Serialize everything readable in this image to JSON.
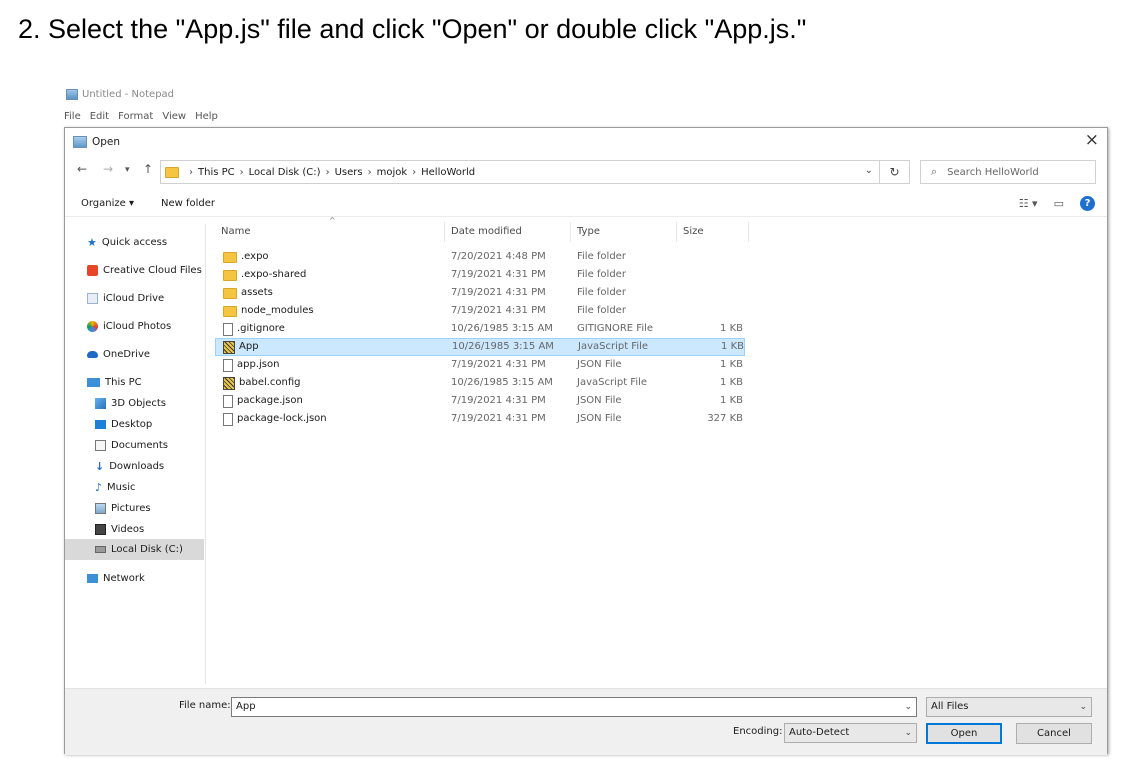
{
  "instruction": "2.  Select the \"App.js\" file and click \"Open\" or double click \"App.js.\"",
  "notepad": {
    "title": "Untitled - Notepad",
    "menu": [
      "File",
      "Edit",
      "Format",
      "View",
      "Help"
    ]
  },
  "dialog": {
    "title": "Open",
    "close": "×",
    "nav": {
      "back": "←",
      "forward": "→",
      "recent": "▾",
      "up": "↑"
    },
    "breadcrumb": [
      "This PC",
      "Local Disk (C:)",
      "Users",
      "mojok",
      "HelloWorld"
    ],
    "search_placeholder": "Search HelloWorld",
    "toolbar": {
      "organize": "Organize ▾",
      "new_folder": "New folder"
    },
    "sidebar": [
      {
        "label": "Quick access",
        "icon": "star-icon"
      },
      {
        "label": "Creative Cloud Files",
        "icon": "creative-cloud-icon"
      },
      {
        "label": "iCloud Drive",
        "icon": "icloud-drive-icon"
      },
      {
        "label": "iCloud Photos",
        "icon": "icloud-photos-icon"
      },
      {
        "label": "OneDrive",
        "icon": "cloud-icon"
      },
      {
        "label": "This PC",
        "icon": "computer-icon"
      },
      {
        "label": "3D Objects",
        "icon": "cube-icon"
      },
      {
        "label": "Desktop",
        "icon": "desktop-icon"
      },
      {
        "label": "Documents",
        "icon": "document-icon"
      },
      {
        "label": "Downloads",
        "icon": "download-icon"
      },
      {
        "label": "Music",
        "icon": "music-icon"
      },
      {
        "label": "Pictures",
        "icon": "picture-icon"
      },
      {
        "label": "Videos",
        "icon": "video-icon"
      },
      {
        "label": "Local Disk (C:)",
        "icon": "drive-icon"
      },
      {
        "label": "Network",
        "icon": "network-icon"
      }
    ],
    "columns": [
      "Name",
      "Date modified",
      "Type",
      "Size"
    ],
    "files": [
      {
        "name": ".expo",
        "date": "7/20/2021 4:48 PM",
        "type": "File folder",
        "size": "",
        "icon": "folder-icon"
      },
      {
        "name": ".expo-shared",
        "date": "7/19/2021 4:31 PM",
        "type": "File folder",
        "size": "",
        "icon": "folder-icon"
      },
      {
        "name": "assets",
        "date": "7/19/2021 4:31 PM",
        "type": "File folder",
        "size": "",
        "icon": "folder-icon"
      },
      {
        "name": "node_modules",
        "date": "7/19/2021 4:31 PM",
        "type": "File folder",
        "size": "",
        "icon": "folder-icon"
      },
      {
        "name": ".gitignore",
        "date": "10/26/1985 3:15 AM",
        "type": "GITIGNORE File",
        "size": "1 KB",
        "icon": "file-icon"
      },
      {
        "name": "App",
        "date": "10/26/1985 3:15 AM",
        "type": "JavaScript File",
        "size": "1 KB",
        "icon": "javascript-file-icon",
        "selected": true
      },
      {
        "name": "app.json",
        "date": "7/19/2021 4:31 PM",
        "type": "JSON File",
        "size": "1 KB",
        "icon": "file-icon"
      },
      {
        "name": "babel.config",
        "date": "10/26/1985 3:15 AM",
        "type": "JavaScript File",
        "size": "1 KB",
        "icon": "javascript-file-icon"
      },
      {
        "name": "package.json",
        "date": "7/19/2021 4:31 PM",
        "type": "JSON File",
        "size": "1 KB",
        "icon": "file-icon"
      },
      {
        "name": "package-lock.json",
        "date": "7/19/2021 4:31 PM",
        "type": "JSON File",
        "size": "327 KB",
        "icon": "file-icon"
      }
    ],
    "bottom": {
      "file_name_label": "File name:",
      "file_name_value": "App",
      "file_type": "All Files",
      "encoding_label": "Encoding:",
      "encoding_value": "Auto-Detect",
      "open": "Open",
      "cancel": "Cancel"
    },
    "colors": {
      "selection": "#cce8ff",
      "selection_border": "#99d1ff",
      "accent": "#0078d7",
      "folder": "#f5c542"
    }
  }
}
